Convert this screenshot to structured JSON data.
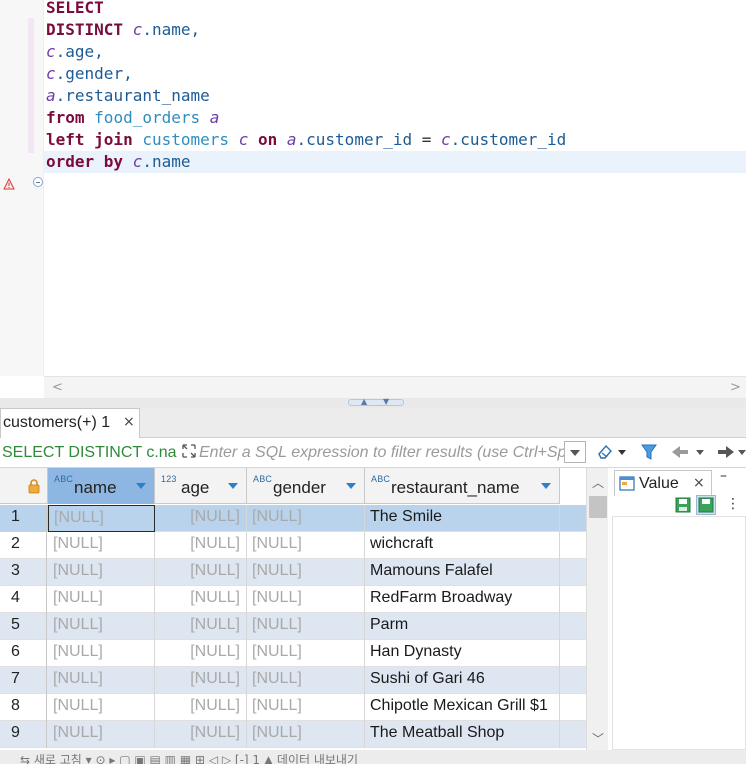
{
  "editor": {
    "sql_lines": [
      [
        {
          "t": "SELECT",
          "k": "kw"
        }
      ],
      [
        {
          "t": "DISTINCT",
          "k": "kw"
        },
        {
          "t": " ",
          "k": "op"
        },
        {
          "t": "c",
          "k": "al"
        },
        {
          "t": ".name,",
          "k": "cl"
        }
      ],
      [
        {
          "t": "c",
          "k": "al"
        },
        {
          "t": ".age,",
          "k": "cl"
        }
      ],
      [
        {
          "t": "c",
          "k": "al"
        },
        {
          "t": ".gender,",
          "k": "cl"
        }
      ],
      [
        {
          "t": "a",
          "k": "al"
        },
        {
          "t": ".restaurant_name",
          "k": "cl"
        }
      ],
      [
        {
          "t": "from",
          "k": "kw"
        },
        {
          "t": " ",
          "k": "op"
        },
        {
          "t": "food_orders",
          "k": "tb"
        },
        {
          "t": " ",
          "k": "op"
        },
        {
          "t": "a",
          "k": "al"
        }
      ],
      [
        {
          "t": "left join",
          "k": "kw"
        },
        {
          "t": " ",
          "k": "op"
        },
        {
          "t": "customers",
          "k": "tb"
        },
        {
          "t": " ",
          "k": "op"
        },
        {
          "t": "c",
          "k": "al"
        },
        {
          "t": " ",
          "k": "op"
        },
        {
          "t": "on",
          "k": "kw"
        },
        {
          "t": " ",
          "k": "op"
        },
        {
          "t": "a",
          "k": "al"
        },
        {
          "t": ".customer_id",
          "k": "cl"
        },
        {
          "t": " = ",
          "k": "op"
        },
        {
          "t": "c",
          "k": "al"
        },
        {
          "t": ".customer_id",
          "k": "cl"
        }
      ],
      [
        {
          "t": "order by",
          "k": "kw"
        },
        {
          "t": " ",
          "k": "op"
        },
        {
          "t": "c",
          "k": "al"
        },
        {
          "t": ".name",
          "k": "cl"
        }
      ]
    ],
    "scroll_left": "<",
    "scroll_right": ">"
  },
  "results": {
    "tab_label": "customers(+) 1",
    "tab_close": "×",
    "query_snippet": "SELECT DISTINCT c.na",
    "filter_placeholder": "Enter a SQL expression to filter results (use Ctrl+Space)",
    "columns": [
      {
        "type": "ABC",
        "name": "name"
      },
      {
        "type": "123",
        "name": "age"
      },
      {
        "type": "ABC",
        "name": "gender"
      },
      {
        "type": "ABC",
        "name": "restaurant_name"
      }
    ],
    "rows": [
      {
        "n": "1",
        "name": "[NULL]",
        "age": "[NULL]",
        "gender": "[NULL]",
        "restaurant": "The Smile"
      },
      {
        "n": "2",
        "name": "[NULL]",
        "age": "[NULL]",
        "gender": "[NULL]",
        "restaurant": "wichcraft"
      },
      {
        "n": "3",
        "name": "[NULL]",
        "age": "[NULL]",
        "gender": "[NULL]",
        "restaurant": "Mamouns Falafel"
      },
      {
        "n": "4",
        "name": "[NULL]",
        "age": "[NULL]",
        "gender": "[NULL]",
        "restaurant": "RedFarm Broadway"
      },
      {
        "n": "5",
        "name": "[NULL]",
        "age": "[NULL]",
        "gender": "[NULL]",
        "restaurant": "Parm"
      },
      {
        "n": "6",
        "name": "[NULL]",
        "age": "[NULL]",
        "gender": "[NULL]",
        "restaurant": "Han Dynasty"
      },
      {
        "n": "7",
        "name": "[NULL]",
        "age": "[NULL]",
        "gender": "[NULL]",
        "restaurant": "Sushi of Gari 46"
      },
      {
        "n": "8",
        "name": "[NULL]",
        "age": "[NULL]",
        "gender": "[NULL]",
        "restaurant": "Chipotle Mexican Grill $1"
      },
      {
        "n": "9",
        "name": "[NULL]",
        "age": "[NULL]",
        "gender": "[NULL]",
        "restaurant": "The Meatball Shop"
      }
    ]
  },
  "value_panel": {
    "tab_label": "Value",
    "tab_close": "×",
    "minimize": "–",
    "more": "⋮"
  },
  "statusbar": {
    "text": "⇆ 새로 고침 ▾ ⊙ ▸ ▢ ▣ ▤ ▥ ▦ ⊞ ◁ ▷ [-] 1 ▲ 데이터 내보내기"
  }
}
